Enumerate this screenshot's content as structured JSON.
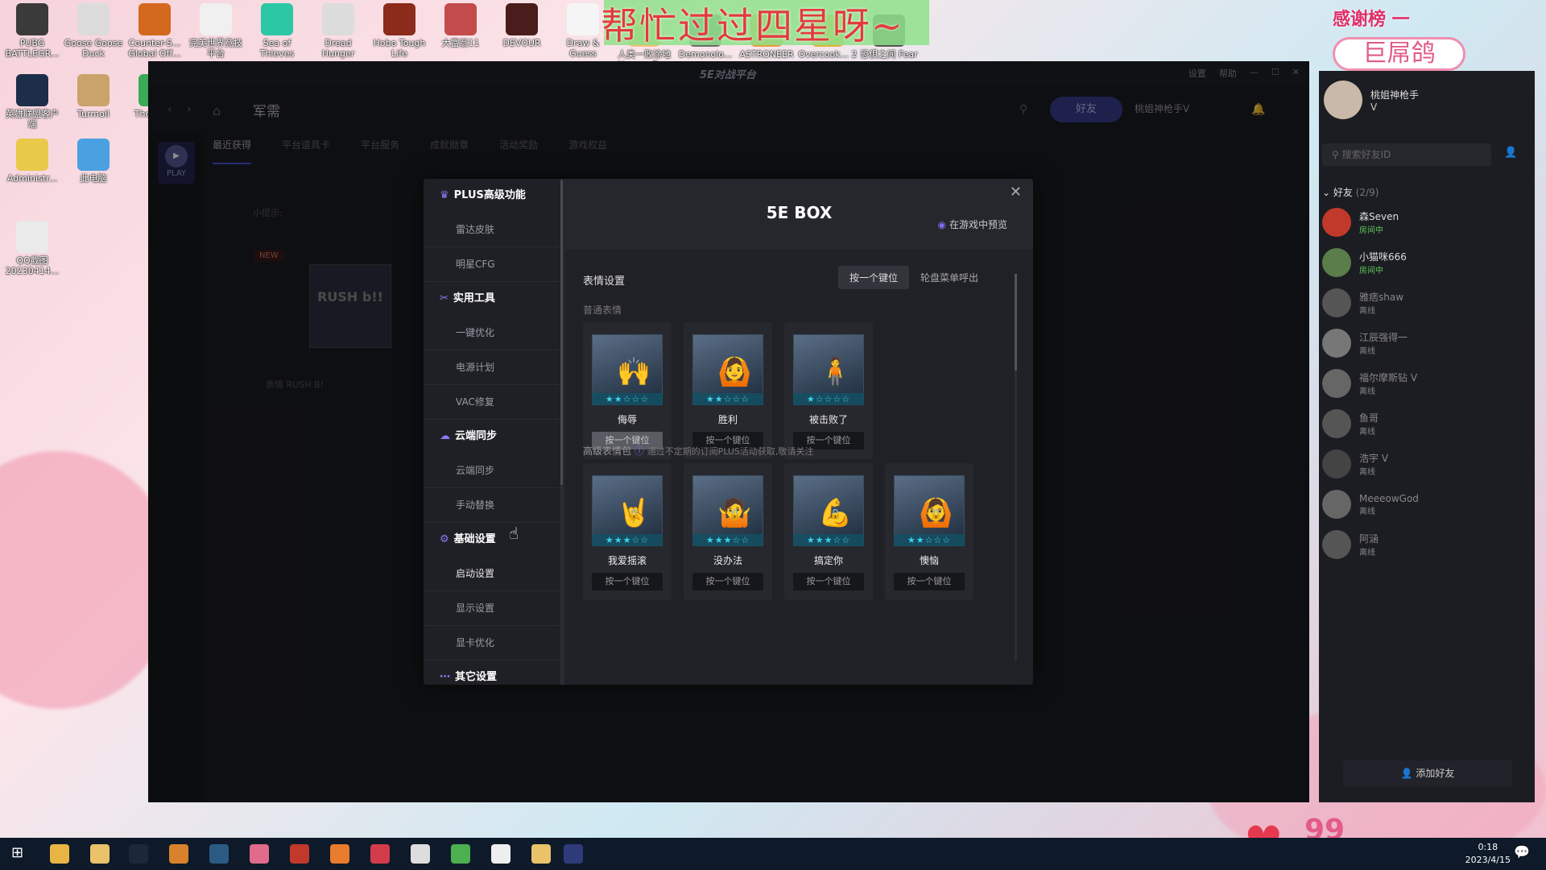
{
  "desktop": {
    "icons": [
      {
        "label": "PUBG BATTLEGR...",
        "color": "#3a3a3a"
      },
      {
        "label": "Goose Goose Duck",
        "color": "#dcdcdc"
      },
      {
        "label": "Counter-S... Global Off...",
        "color": "#d2691e"
      },
      {
        "label": "完美世界竞技平台",
        "color": "#f0f0f0"
      },
      {
        "label": "Sea of Thieves",
        "color": "#2cc7a5"
      },
      {
        "label": "Dread Hunger",
        "color": "#dcdcdc"
      },
      {
        "label": "Hobo Tough Life",
        "color": "#8b2b1c"
      },
      {
        "label": "大富翁11",
        "color": "#c34b4b"
      },
      {
        "label": "DEVOUR",
        "color": "#4a1c1c"
      },
      {
        "label": "Draw & Guess",
        "color": "#f5f5f5"
      },
      {
        "label": "人类一败涂地 Human Fa...",
        "color": "#f2c27a"
      },
      {
        "label": "Demonolo...",
        "color": "#6a6a6a"
      },
      {
        "label": "ASTRONEER",
        "color": "#e89c3e"
      },
      {
        "label": "Overcook... 2",
        "color": "#e4b23c"
      },
      {
        "label": "恐惧之间 Fear sur...",
        "color": "#555"
      },
      {
        "label": "英雄联盟客户端",
        "color": "#1c2e4a"
      },
      {
        "label": "Turmoil",
        "color": "#c9a36a"
      },
      {
        "label": "The Sims",
        "color": "#3aaa5a"
      },
      {
        "label": "Administr...",
        "color": "#e8c94a"
      },
      {
        "label": "此电脑",
        "color": "#4aa0e0"
      },
      {
        "label": "QQ截图 20230414...",
        "color": "#eaeaea"
      }
    ],
    "banner_text": "帮忙过过四星呀~",
    "thanks_text": "感谢榜 一",
    "pigeon_text": "巨屌鸽",
    "overlay_number": "99"
  },
  "app": {
    "logo": "5E对战平台",
    "title_links": [
      "设置",
      "帮助"
    ],
    "nav_title": "军需",
    "friends_button": "好友",
    "username": "桃姐神枪手V",
    "play_label": "PLAY",
    "subtabs": [
      "最近获得",
      "平台道具卡",
      "平台服务",
      "成就勋章",
      "活动奖励",
      "游戏权益"
    ],
    "tip_label": "小提示:",
    "new_tag": "NEW",
    "rush_card_text": "RUSH b!!",
    "rush_label": "表情  RUSH B!"
  },
  "modal": {
    "title": "5E BOX",
    "preview_label": "在游戏中预览",
    "sidebar": [
      {
        "type": "section",
        "label": "PLUS高级功能",
        "icon": "crown-icon"
      },
      {
        "type": "item",
        "label": "雷达皮肤"
      },
      {
        "type": "item",
        "label": "明星CFG"
      },
      {
        "type": "section",
        "label": "实用工具",
        "icon": "tools-icon"
      },
      {
        "type": "item",
        "label": "一键优化"
      },
      {
        "type": "item",
        "label": "电源计划"
      },
      {
        "type": "item",
        "label": "VAC修复"
      },
      {
        "type": "section",
        "label": "云端同步",
        "icon": "cloud-icon"
      },
      {
        "type": "item",
        "label": "云端同步"
      },
      {
        "type": "item",
        "label": "手动替换"
      },
      {
        "type": "section",
        "label": "基础设置",
        "icon": "settings-icon"
      },
      {
        "type": "item",
        "label": "启动设置"
      },
      {
        "type": "item",
        "label": "显示设置"
      },
      {
        "type": "item",
        "label": "显卡优化"
      },
      {
        "type": "section",
        "label": "其它设置",
        "icon": "more-icon"
      }
    ],
    "emote_settings_label": "表情设置",
    "segment": [
      "按一个键位",
      "轮盘菜单呼出"
    ],
    "normal_label": "普通表情",
    "premium_label": "高级表情包",
    "premium_note": "通过不定期的订阅PLUS活动获取,敬请关注",
    "bind_label": "按一个键位",
    "normal_emotes": [
      {
        "name": "侮辱",
        "stars": "★★☆☆☆",
        "figure": "🙌"
      },
      {
        "name": "胜利",
        "stars": "★★☆☆☆",
        "figure": "🙆"
      },
      {
        "name": "被击败了",
        "stars": "★☆☆☆☆",
        "figure": "🧍"
      }
    ],
    "premium_emotes": [
      {
        "name": "我爱摇滚",
        "stars": "★★★☆☆",
        "figure": "🤘"
      },
      {
        "name": "没办法",
        "stars": "★★★☆☆",
        "figure": "🤷"
      },
      {
        "name": "搞定你",
        "stars": "★★★☆☆",
        "figure": "💪"
      },
      {
        "name": "懊恼",
        "stars": "★★☆☆☆",
        "figure": "🙆"
      }
    ]
  },
  "friends": {
    "my_name": "桃姐神枪手",
    "my_badge": "V",
    "search_placeholder": "搜索好友ID",
    "group_label": "好友",
    "group_count": "(2/9)",
    "list": [
      {
        "name": "森Seven",
        "status": "房间中",
        "online": true
      },
      {
        "name": "小猫咪666",
        "status": "房间中",
        "online": true
      },
      {
        "name": "雅痞shaw",
        "status": "离线",
        "online": false
      },
      {
        "name": "江辰强得一",
        "status": "离线",
        "online": false
      },
      {
        "name": "福尔摩斯钻 V",
        "status": "离线",
        "online": false
      },
      {
        "name": "鱼哥",
        "status": "离线",
        "online": false
      },
      {
        "name": "浩宇 V",
        "status": "离线",
        "online": false
      },
      {
        "name": "MeeeowGod",
        "status": "离线",
        "online": false
      },
      {
        "name": "阿涵",
        "status": "离线",
        "online": false
      }
    ],
    "add_friend": "添加好友"
  },
  "taskbar": {
    "time": "0:18",
    "date": "2023/4/15"
  }
}
